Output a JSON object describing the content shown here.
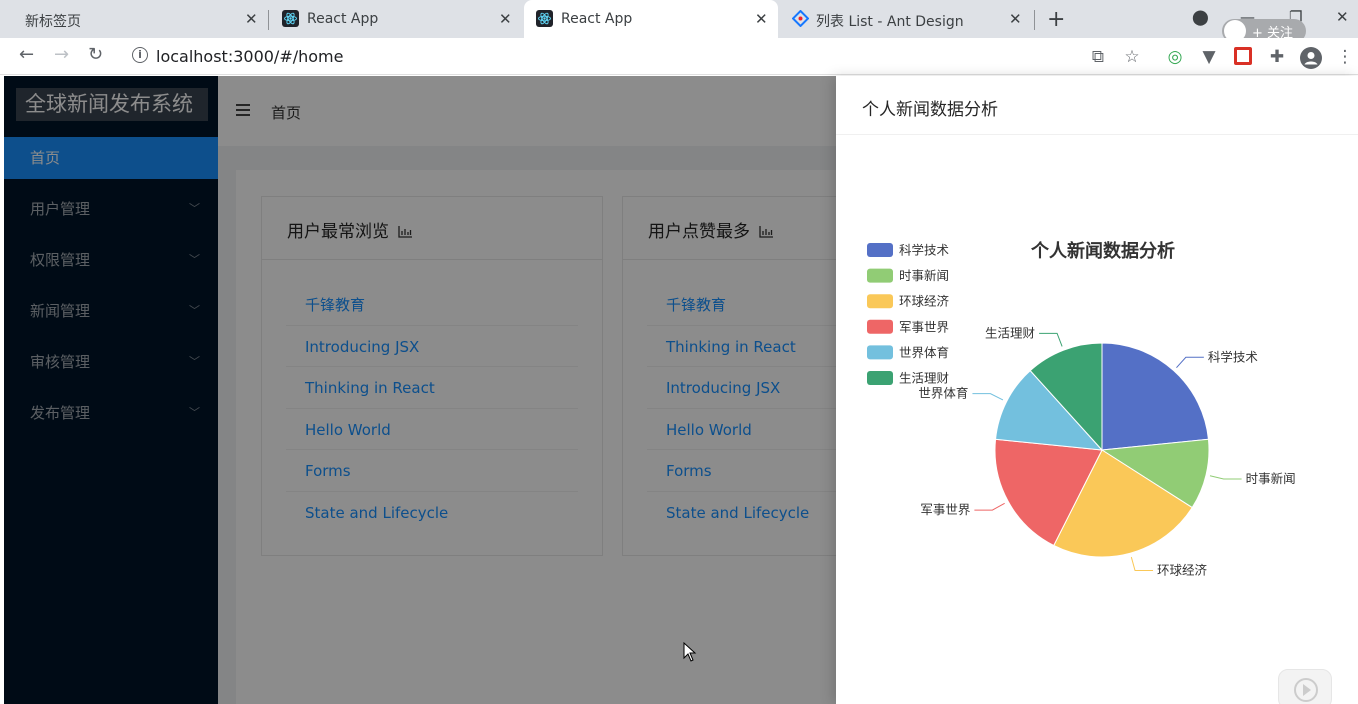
{
  "browser": {
    "tabs": [
      {
        "label": "新标签页"
      },
      {
        "label": "React App"
      },
      {
        "label": "React App"
      },
      {
        "label": "列表 List - Ant Design"
      }
    ],
    "url": "localhost:3000/#/home",
    "follow_label": "+ 关注"
  },
  "app": {
    "logo": "全球新闻发布系统",
    "menu": [
      {
        "label": "首页"
      },
      {
        "label": "用户管理"
      },
      {
        "label": "权限管理"
      },
      {
        "label": "新闻管理"
      },
      {
        "label": "审核管理"
      },
      {
        "label": "发布管理"
      }
    ],
    "breadcrumb": "首页",
    "cards": [
      {
        "title": "用户最常浏览",
        "items": [
          "千锋教育",
          "Introducing JSX",
          "Thinking in React",
          "Hello World",
          "Forms",
          "State and Lifecycle"
        ]
      },
      {
        "title": "用户点赞最多",
        "items": [
          "千锋教育",
          "Thinking in React",
          "Introducing JSX",
          "Hello World",
          "Forms",
          "State and Lifecycle"
        ]
      }
    ]
  },
  "drawer": {
    "title": "个人新闻数据分析"
  },
  "chart_data": {
    "type": "pie",
    "title": "个人新闻数据分析",
    "legend_position": "top-left",
    "categories": [
      "科学技术",
      "时事新闻",
      "环球经济",
      "军事世界",
      "世界体育",
      "生活理财"
    ],
    "values": [
      22,
      10,
      22,
      18,
      11,
      11
    ],
    "colors": [
      "#5470c6",
      "#91cc75",
      "#fac858",
      "#ee6666",
      "#73c0de",
      "#3ba272"
    ]
  }
}
